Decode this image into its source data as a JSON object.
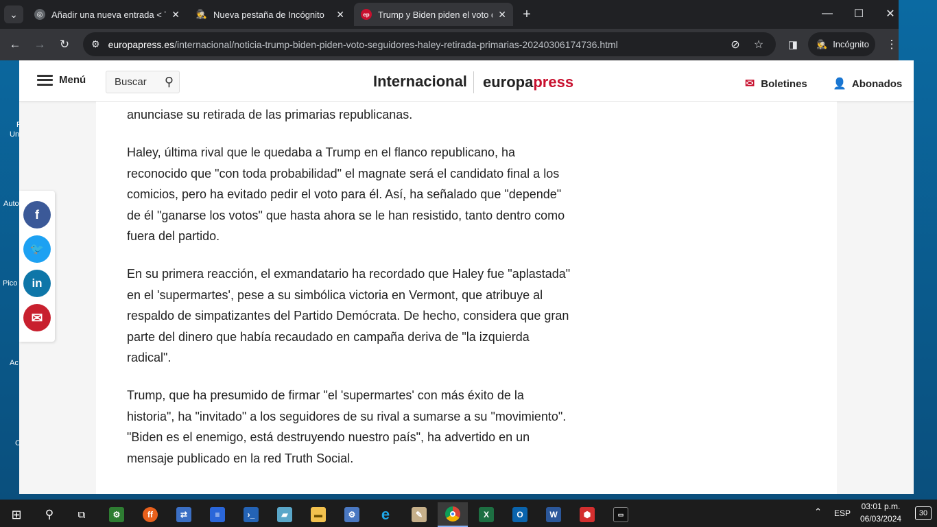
{
  "browser": {
    "tabs": [
      {
        "title": "Añadir una nueva entrada < Tac",
        "active": false
      },
      {
        "title": "Nueva pestaña de Incógnito",
        "active": false
      },
      {
        "title": "Trump y Biden piden el voto de",
        "active": true
      }
    ],
    "url_host": "europapress.es",
    "url_path": "/internacional/noticia-trump-biden-piden-voto-seguidores-haley-retirada-primarias-20240306174736.html",
    "incognito_label": "Incógnito"
  },
  "site": {
    "menu_label": "Menú",
    "search_placeholder": "Buscar",
    "section": "Internacional",
    "brand_part1": "europa",
    "brand_part2": "press",
    "newsletters_label": "Boletines",
    "subscribers_label": "Abonados",
    "accent_color": "#c8102e"
  },
  "article": {
    "paragraphs": [
      "anunciase su retirada de las primarias republicanas.",
      "Haley, última rival que le quedaba a Trump en el flanco republicano, ha reconocido que \"con toda probabilidad\" el magnate será el candidato final a los comicios, pero ha evitado pedir el voto para él. Así, ha señalado que \"depende\" de él \"ganarse los votos\" que hasta ahora se le han resistido, tanto dentro como fuera del partido.",
      "En su primera reacción, el exmandatario ha recordado que Haley fue \"aplastada\" en el 'supermartes', pese a su simbólica victoria en Vermont, que atribuye al respaldo de simpatizantes del Partido Demócrata. De hecho, considera que gran parte del dinero que había recaudado en campaña deriva de \"la izquierda radical\".",
      "Trump, que ha presumido de firmar \"el 'supermartes' con más éxito de la historia\", ha \"invitado\" a los seguidores de su rival a sumarse a su \"movimiento\". \"Biden es el enemigo, está destruyendo nuestro país\", ha advertido en un mensaje publicado en la red Truth Social."
    ]
  },
  "social": {
    "buttons": [
      {
        "name": "facebook",
        "glyph": "f",
        "color": "#3b5998"
      },
      {
        "name": "twitter",
        "glyph": "🐦",
        "color": "#1da1f2"
      },
      {
        "name": "linkedin",
        "glyph": "in",
        "color": "#0e76a8"
      },
      {
        "name": "email",
        "glyph": "✉",
        "color": "#c8202e"
      }
    ]
  },
  "desktop": {
    "labels": [
      "F",
      "Un",
      "Auto",
      "Pico",
      "Ac",
      "C"
    ]
  },
  "taskbar": {
    "language": "ESP",
    "time": "03:01 p.m.",
    "date": "06/03/2024",
    "notifications": "30"
  }
}
